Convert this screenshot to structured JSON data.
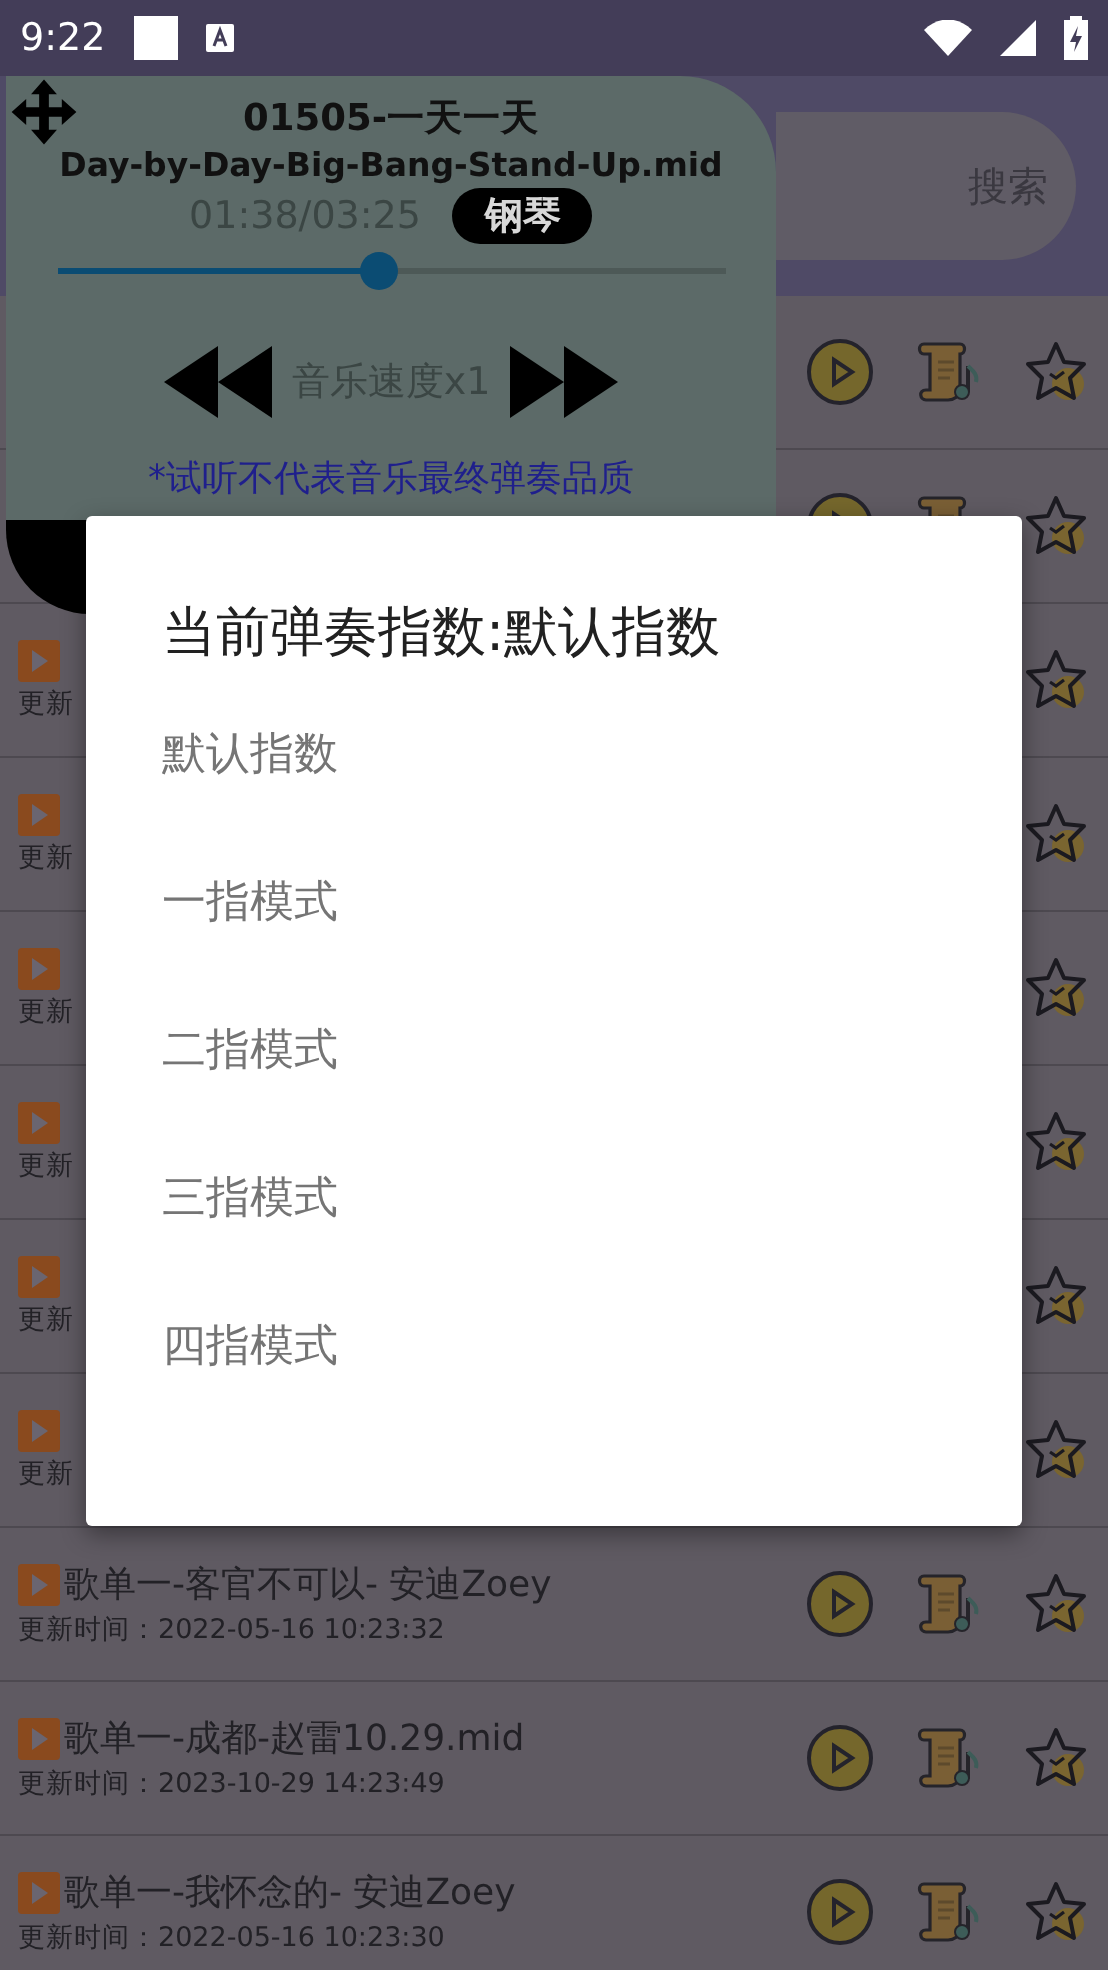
{
  "status_bar": {
    "time": "9:22"
  },
  "search": {
    "button": "搜索"
  },
  "player": {
    "title": "01505-一天一天",
    "file": "Day-by-Day-Big-Bang-Stand-Up.mid",
    "time": "01:38/03:25",
    "instrument": "钢琴",
    "level": 0.48,
    "speed": "音乐速度x1",
    "note": "*试听不代表音乐最终弹奏品质"
  },
  "songs": [
    {
      "kind": "covered"
    },
    {
      "kind": "covered"
    },
    {
      "kind": "partial",
      "updated": "更新"
    },
    {
      "kind": "partial",
      "updated": "更新"
    },
    {
      "kind": "partial",
      "updated": "更新"
    },
    {
      "kind": "partial",
      "updated": "更新"
    },
    {
      "kind": "partial",
      "updated": "更新"
    },
    {
      "kind": "partial",
      "updated": "更新"
    },
    {
      "kind": "full",
      "title": "歌单一-客官不可以- 安迪Zoey",
      "updated": "更新时间：2022-05-16 10:23:32"
    },
    {
      "kind": "full",
      "title": "歌单一-成都-赵雷10.29.mid",
      "updated": "更新时间：2023-10-29 14:23:49"
    },
    {
      "kind": "full",
      "title": "歌单一-我怀念的- 安迪Zoey",
      "updated": "更新时间：2022-05-16 10:23:30"
    }
  ],
  "dialog": {
    "title": "当前弹奏指数:默认指数",
    "options": [
      "默认指数",
      "一指模式",
      "二指模式",
      "三指模式",
      "四指模式"
    ]
  }
}
